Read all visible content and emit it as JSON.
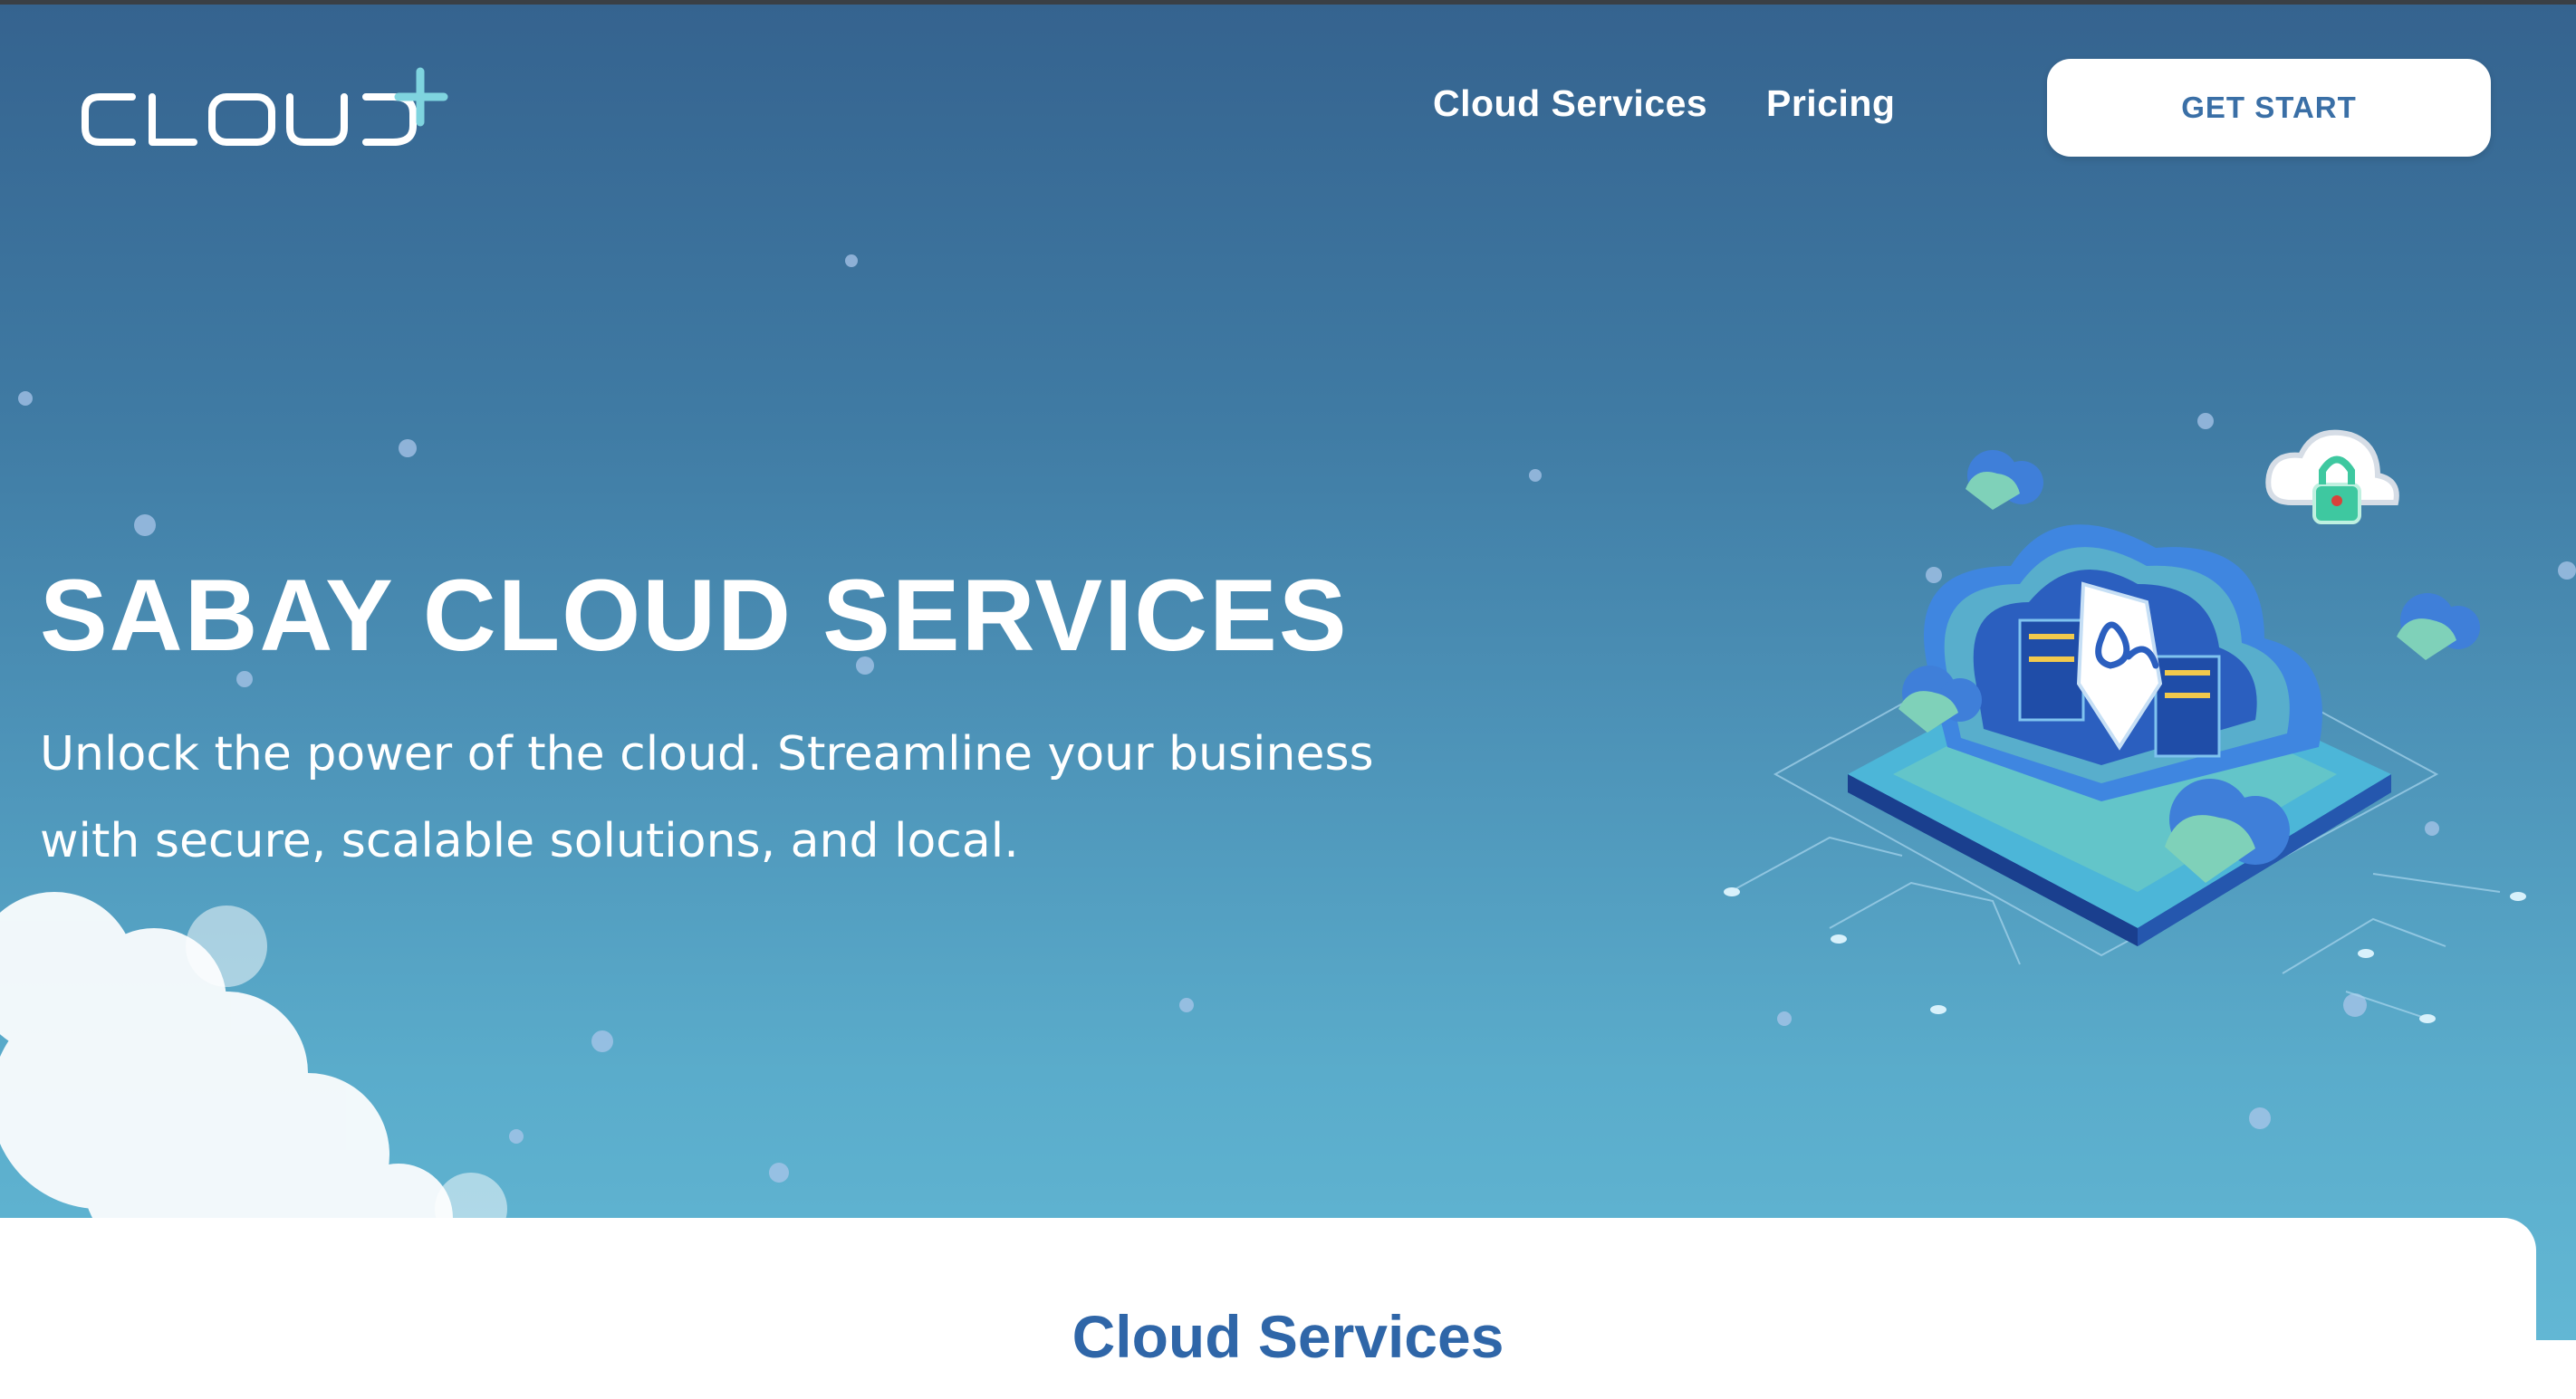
{
  "header": {
    "logo_text": "cloud+",
    "nav": [
      {
        "label": "Cloud Services"
      },
      {
        "label": "Pricing"
      }
    ],
    "cta_label": "GET START"
  },
  "hero": {
    "title": "SABAY CLOUD SERVICES",
    "subtitle": "Unlock the power of the cloud. Streamline your business with secure, scalable solutions, and local."
  },
  "section": {
    "title": "Cloud Services"
  },
  "colors": {
    "hero_top": "#35638f",
    "hero_bottom": "#62b7d4",
    "accent_blue": "#3a6fa6",
    "section_title": "#2f66a8",
    "logo_plus": "#7fd4df"
  },
  "icons": [
    "cloud-plus-logo",
    "cloud-server-illustration",
    "cloud-lock-icon"
  ]
}
